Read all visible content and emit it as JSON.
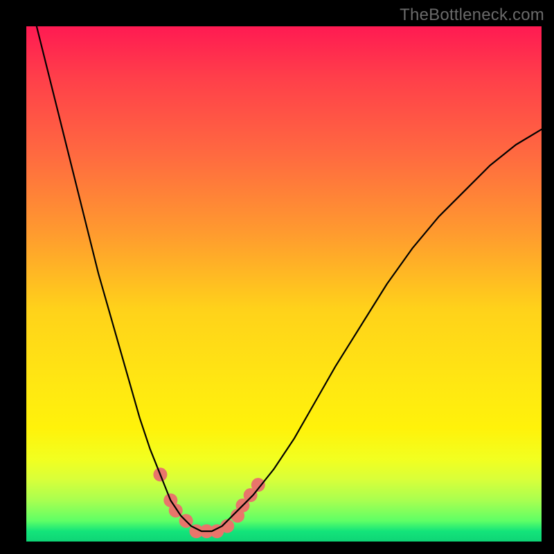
{
  "watermark": "TheBottleneck.com",
  "chart_data": {
    "type": "line",
    "title": "",
    "xlabel": "",
    "ylabel": "",
    "xlim": [
      0,
      100
    ],
    "ylim": [
      0,
      100
    ],
    "grid": false,
    "legend": false,
    "background_gradient": [
      {
        "stop": 0.0,
        "color": "#ff1a52"
      },
      {
        "stop": 0.55,
        "color": "#ffd21a"
      },
      {
        "stop": 0.84,
        "color": "#f2ff20"
      },
      {
        "stop": 1.0,
        "color": "#0ed576"
      }
    ],
    "series": [
      {
        "name": "bottleneck-curve",
        "stroke": "#000000",
        "stroke_width": 2.2,
        "x": [
          0,
          2,
          4,
          6,
          8,
          10,
          12,
          14,
          16,
          18,
          20,
          22,
          24,
          26,
          28,
          30,
          31,
          32,
          34,
          36,
          38,
          40,
          44,
          48,
          52,
          56,
          60,
          65,
          70,
          75,
          80,
          85,
          90,
          95,
          100
        ],
        "y": [
          108,
          100,
          92,
          84,
          76,
          68,
          60,
          52,
          45,
          38,
          31,
          24,
          18,
          13,
          8,
          5,
          4,
          3,
          2,
          2,
          3,
          5,
          9,
          14,
          20,
          27,
          34,
          42,
          50,
          57,
          63,
          68,
          73,
          77,
          80
        ]
      }
    ],
    "markers": [
      {
        "name": "bottleneck-highlight-dots",
        "fill": "#e8756b",
        "radius": 10,
        "points": [
          {
            "x": 26,
            "y": 13
          },
          {
            "x": 28,
            "y": 8
          },
          {
            "x": 29,
            "y": 6
          },
          {
            "x": 31,
            "y": 4
          },
          {
            "x": 33,
            "y": 2
          },
          {
            "x": 35,
            "y": 2
          },
          {
            "x": 37,
            "y": 2
          },
          {
            "x": 39,
            "y": 3
          },
          {
            "x": 41,
            "y": 5
          },
          {
            "x": 42,
            "y": 7
          },
          {
            "x": 43.5,
            "y": 9
          },
          {
            "x": 45,
            "y": 11
          }
        ]
      }
    ]
  }
}
